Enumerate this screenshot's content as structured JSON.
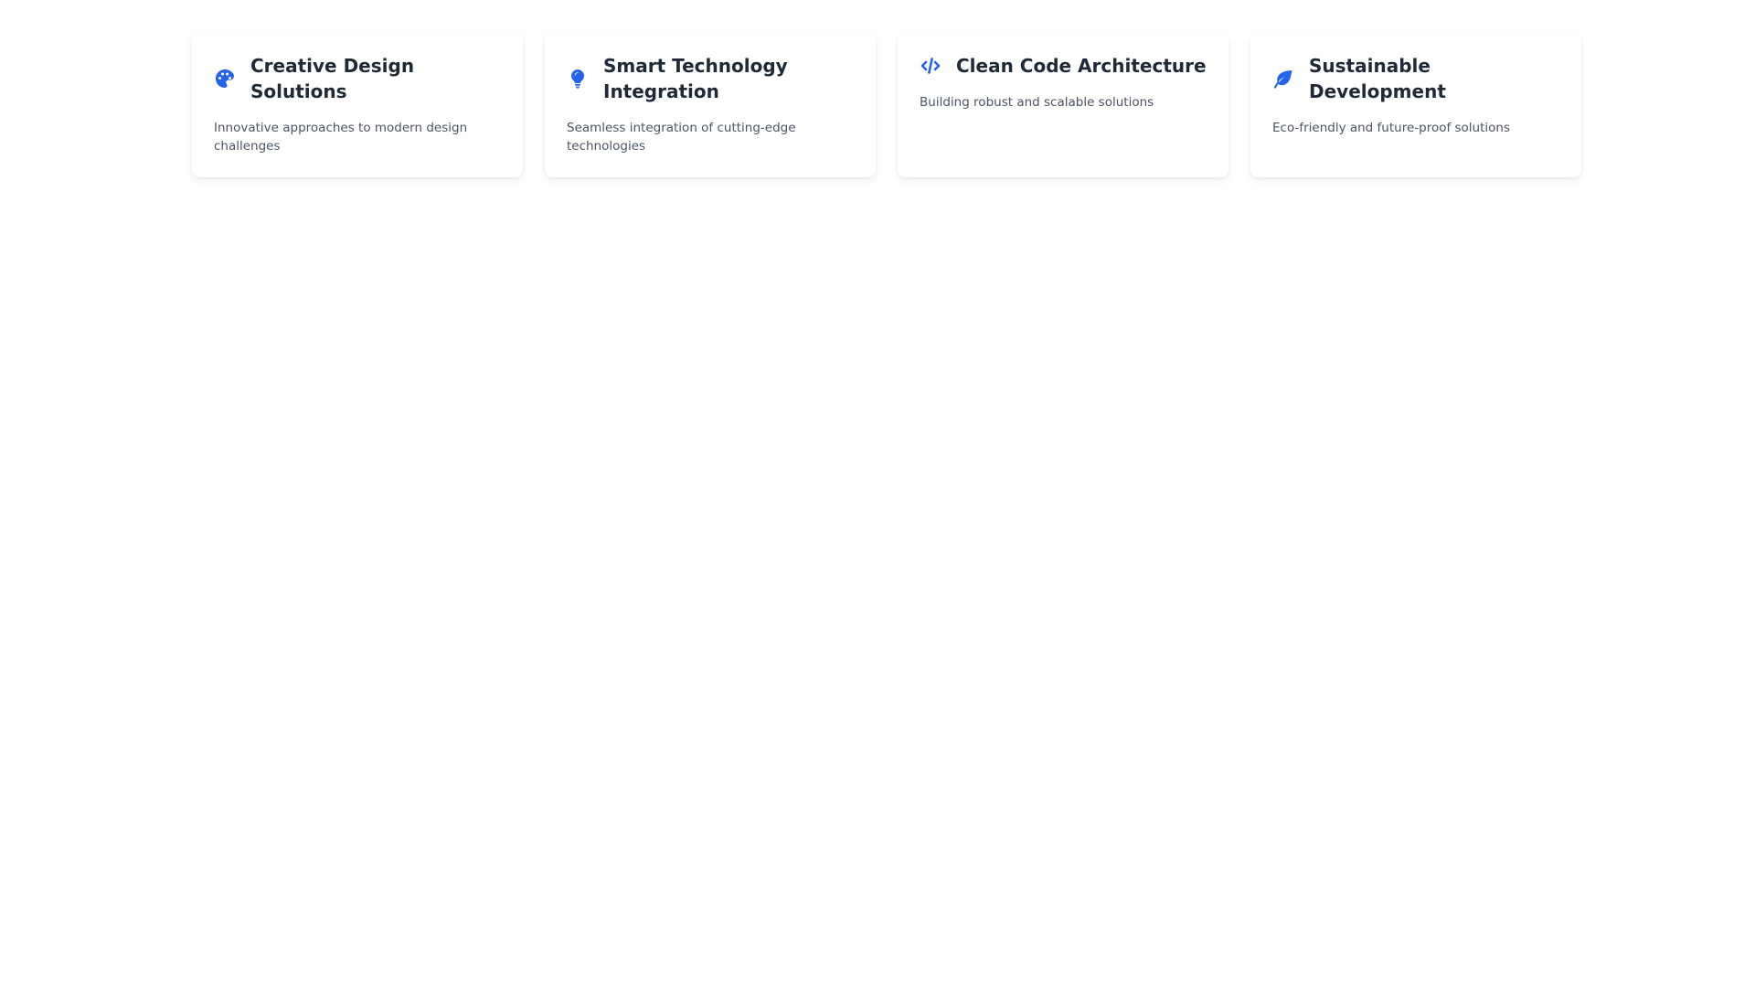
{
  "theme": {
    "accent_color": "#2563eb",
    "title_color": "#1f2937",
    "text_color": "#4b5563",
    "card_background": "#ffffff",
    "page_background": "#ffffff"
  },
  "cards": [
    {
      "icon": "palette-icon",
      "title": "Creative Design Solutions",
      "description": "Innovative approaches to modern design challenges"
    },
    {
      "icon": "lightbulb-icon",
      "title": "Smart Technology Integration",
      "description": "Seamless integration of cutting-edge technologies"
    },
    {
      "icon": "code-icon",
      "title": "Clean Code Architecture",
      "description": "Building robust and scalable solutions"
    },
    {
      "icon": "leaf-icon",
      "title": "Sustainable Development",
      "description": "Eco-friendly and future-proof solutions"
    }
  ]
}
